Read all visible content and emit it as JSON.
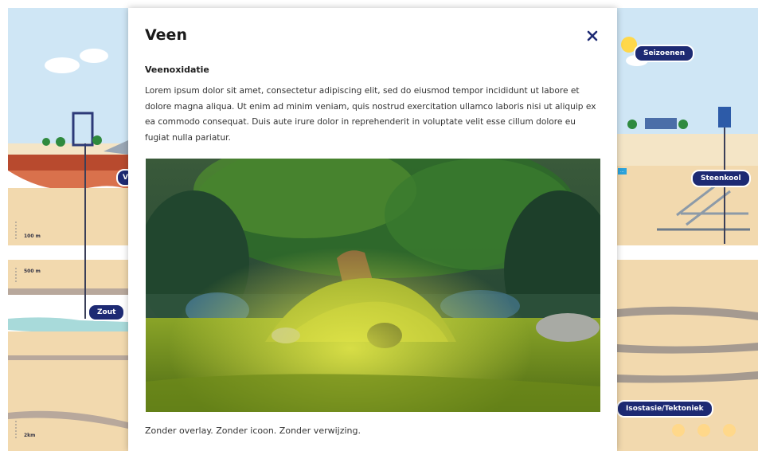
{
  "modal": {
    "title": "Veen",
    "subheading": "Veenoxidatie",
    "paragraph": "Lorem ipsum dolor sit amet, consectetur adipiscing elit, sed do eiusmod tempor incididunt ut labore et dolore magna aliqua. Ut enim ad minim veniam, quis nostrud exercitation ullamco laboris nisi ut aliquip ex ea commodo consequat. Duis aute irure dolor in reprehenderit in voluptate velit esse cillum dolore eu fugiat nulla pariatur.",
    "caption": "Zonder overlay. Zonder icoon. Zonder verwijzing.",
    "close_icon": "close-icon"
  },
  "background": {
    "labels": {
      "zout": "Zout",
      "seizoenen": "Seizoenen",
      "steenkool": "Steenkool",
      "isostasie": "Isostasie/Tektoniek",
      "left_partial": "V",
      "depth_100": "100 m",
      "depth_500": "500 m",
      "depth_2km": "2km",
      "small_tag": "..."
    }
  },
  "colors": {
    "pill_bg": "#1d2a73",
    "sky": "#cfe6f5",
    "sand": "#f1dcb6",
    "red_layer": "#b84a2e",
    "modal_text": "#333333"
  }
}
